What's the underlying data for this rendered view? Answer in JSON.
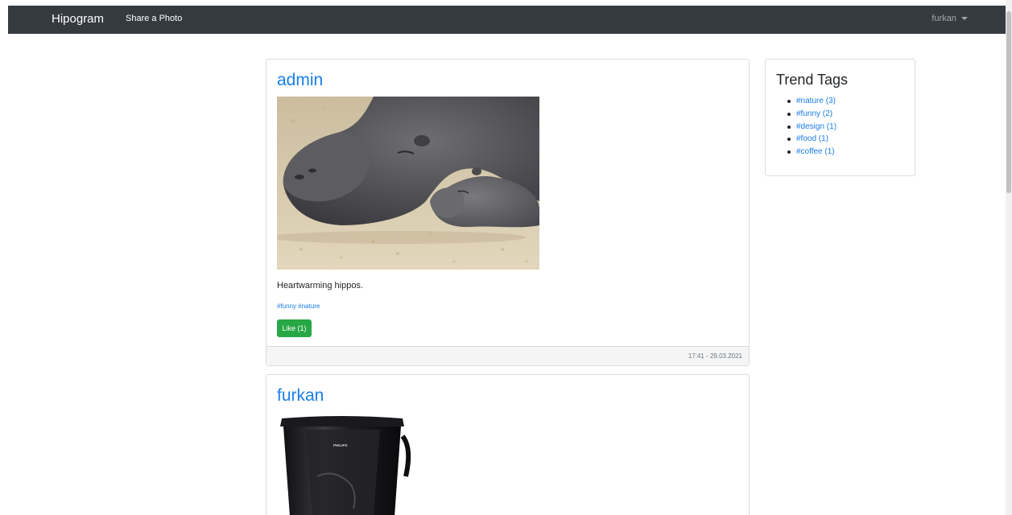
{
  "navbar": {
    "brand": "Hipogram",
    "share_label": "Share a Photo",
    "user": "furkan",
    "bg_color": "#343a40"
  },
  "posts": [
    {
      "author": "admin",
      "photo_icon": "hippos-photo",
      "caption": "Heartwarming hippos.",
      "tags": "#funny #nature",
      "like_label": "Like (1)",
      "timestamp": "17:41 - 29.03.2021"
    },
    {
      "author": "furkan",
      "photo_icon": "coffee-maker-photo",
      "brand_text": "PHILIPS"
    }
  ],
  "trend": {
    "title": "Trend Tags",
    "tags": [
      "#nature (3)",
      "#funny (2)",
      "#design (1)",
      "#food (1)",
      "#coffee (1)"
    ]
  },
  "colors": {
    "link": "#1a7ee8",
    "like_button": "#28a745"
  }
}
